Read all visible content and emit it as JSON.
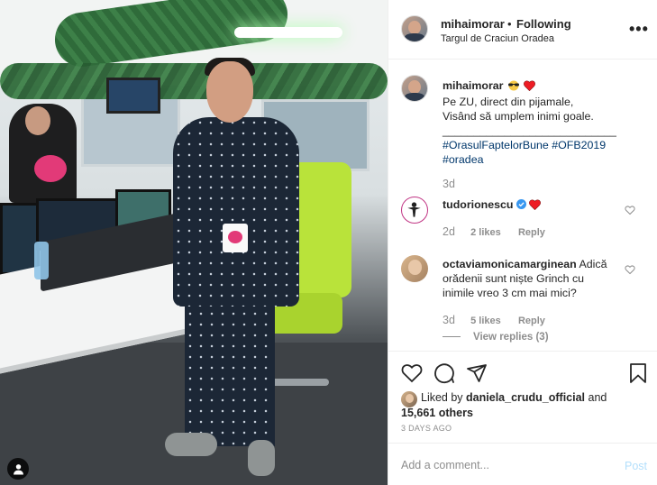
{
  "post": {
    "username": "mihaimorar",
    "separator": "•",
    "follow_state": "Following",
    "location": "Targul de Craciun Oradea",
    "more_menu": "•••"
  },
  "caption": {
    "username": "mihaimorar",
    "lines": [
      "Pe ZU, direct din pijamale,",
      "Visând să umplem inimi goale.",
      "____________________________"
    ],
    "hashtags": [
      "#OrasulFaptelorBune",
      "#OFB2019",
      "#oradea"
    ],
    "time": "3d"
  },
  "comments": [
    {
      "username": "tudorionescu",
      "text": "",
      "time": "2d",
      "likes": "2 likes",
      "reply_label": "Reply"
    },
    {
      "username": "octaviamonicamarginean",
      "text_lines": [
        "Adică",
        "orădenii sunt niște Grinch cu",
        "inimile vreo 3 cm mai mici?"
      ],
      "time": "3d",
      "likes": "5 likes",
      "reply_label": "Reply",
      "view_replies": "View replies (3)"
    }
  ],
  "likes_section": {
    "prefix": "Liked by",
    "liker": "daniela_crudu_official",
    "and_text": "and",
    "others": "15,661 others",
    "date": "3 DAYS AGO"
  },
  "add_comment": {
    "placeholder": "Add a comment...",
    "post_label": "Post"
  },
  "colors": {
    "heart_red": "#ed4956",
    "verified_blue": "#3897f0",
    "hashtag": "#00376b",
    "muted": "#8e8e8e",
    "post_disabled": "#b2dffc"
  },
  "icons": [
    "heart-icon",
    "comment-icon",
    "share-icon",
    "bookmark-icon",
    "user-tag-icon",
    "verified-icon",
    "more-icon"
  ]
}
